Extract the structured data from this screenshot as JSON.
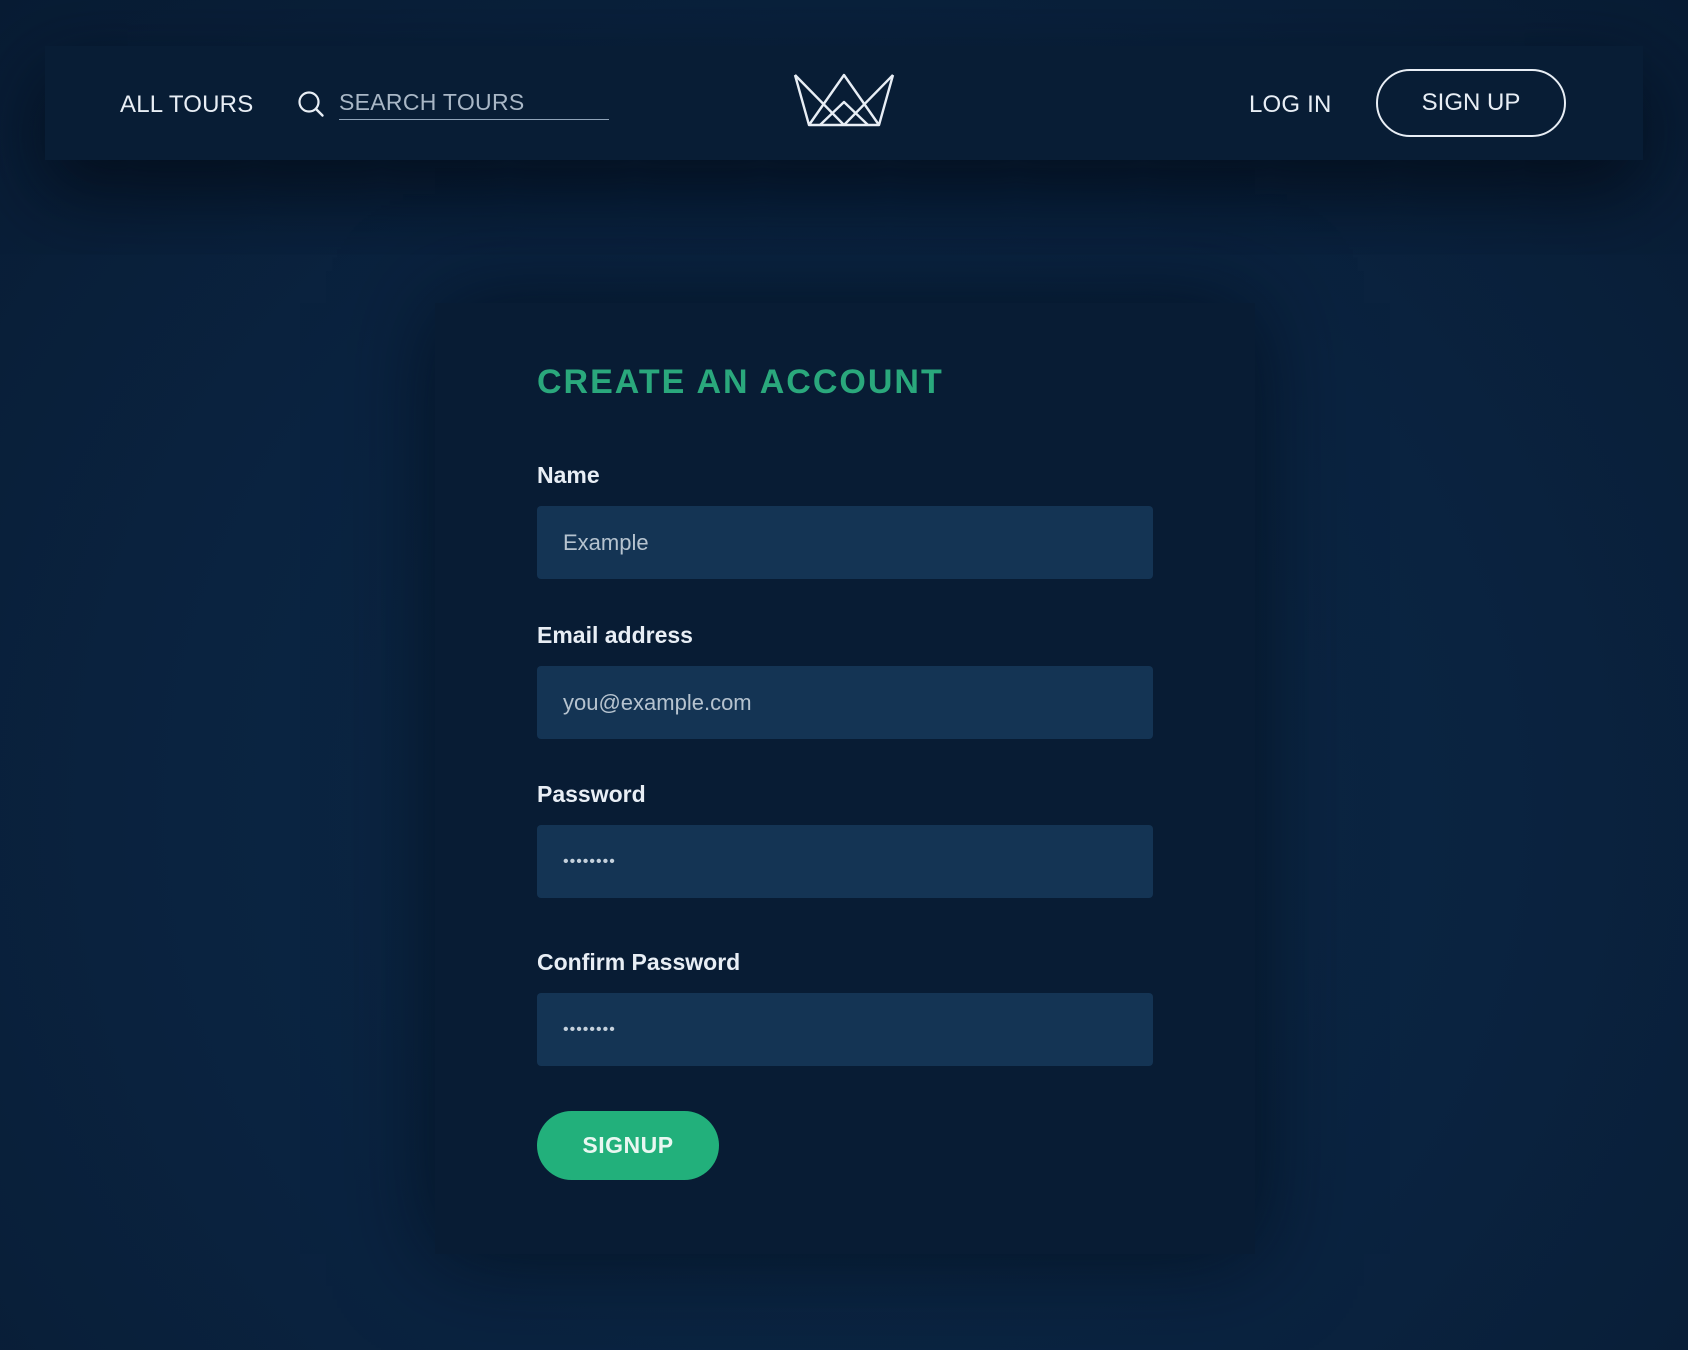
{
  "header": {
    "all_tours_label": "ALL TOURS",
    "search_placeholder": "SEARCH TOURS",
    "search_icon": "search-icon",
    "logo_icon": "crown-logo-icon",
    "log_in_label": "LOG IN",
    "sign_up_label": "SIGN UP"
  },
  "form": {
    "title": "CREATE AN ACCOUNT",
    "fields": [
      {
        "label": "Name",
        "placeholder": "Example",
        "value": ""
      },
      {
        "label": "Email address",
        "placeholder": "you@example.com",
        "value": ""
      },
      {
        "label": "Password",
        "value": "••••••••"
      },
      {
        "label": "Confirm Password",
        "value": "••••••••"
      }
    ],
    "submit_label": "SIGNUP"
  },
  "colors": {
    "background": "#0b2540",
    "header_bg": "#081d35",
    "card_bg": "#081c34",
    "input_bg": "#143454",
    "accent_green": "#22b07b",
    "title_green": "#2aa87c",
    "text_light": "#e8eef5"
  }
}
